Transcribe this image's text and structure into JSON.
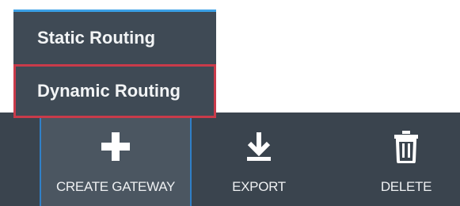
{
  "menu": {
    "items": [
      {
        "label": "Static Routing"
      },
      {
        "label": "Dynamic Routing"
      }
    ]
  },
  "toolbar": {
    "create_label": "CREATE GATEWAY",
    "export_label": "EXPORT",
    "delete_label": "DELETE"
  },
  "colors": {
    "toolbar_bg": "#3a444e",
    "menu_bg": "#3f4a55",
    "highlight_border": "#c93b4a",
    "accent_blue": "#3aa0e6"
  },
  "icons": {
    "create": "plus-icon",
    "export": "download-icon",
    "delete": "trash-icon"
  }
}
